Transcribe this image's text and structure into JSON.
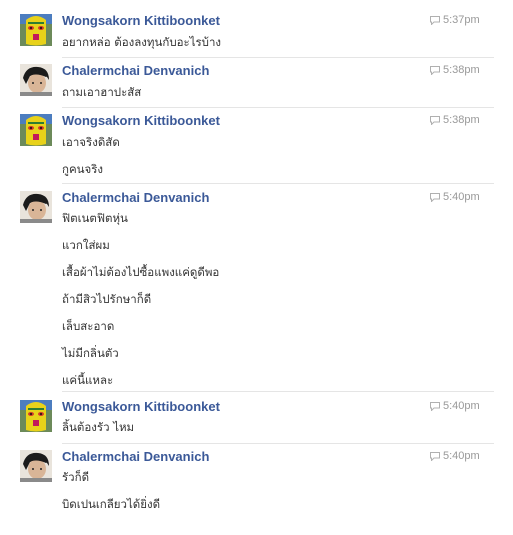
{
  "messages": [
    {
      "author": "Wongsakorn Kittiboonket",
      "avatar_icon": "mask-avatar-icon",
      "time": "5:37pm",
      "lines": [
        "อยากหล่อ ต้องลงทุนกับอะไรบ้าง"
      ]
    },
    {
      "author": "Chalermchai Denvanich",
      "avatar_icon": "person-avatar-icon",
      "time": "5:38pm",
      "lines": [
        "ถามเอาฮาปะสัส"
      ]
    },
    {
      "author": "Wongsakorn Kittiboonket",
      "avatar_icon": "mask-avatar-icon",
      "time": "5:38pm",
      "lines": [
        "เอาจริงดิสัด",
        "กูคนจริง"
      ]
    },
    {
      "author": "Chalermchai Denvanich",
      "avatar_icon": "person-avatar-icon",
      "time": "5:40pm",
      "lines": [
        "ฟิตเนตฟิตหุ่น",
        "แวกใส่ผม",
        "เสื้อผ้าไม่ต้องไปซื้อแพงแค่ดูดีพอ",
        "ถ้ามีสิวไปรักษาก็ดี",
        "เล็บสะอาด",
        "ไม่มีกลิ่นตัว",
        "แค่นี้แหละ"
      ]
    },
    {
      "author": "Wongsakorn Kittiboonket",
      "avatar_icon": "mask-avatar-icon",
      "time": "5:40pm",
      "lines": [
        "ลิ้นต้องรัว ไหม"
      ]
    },
    {
      "author": "Chalermchai Denvanich",
      "avatar_icon": "person-avatar-icon",
      "time": "5:40pm",
      "lines": [
        "รัวก็ดี",
        "บิดเปนเกลียวได้ยิ่งดี"
      ]
    }
  ],
  "colors": {
    "author": "#3b5998",
    "time": "#999999",
    "text": "#333333",
    "divider": "#e5e5e5"
  }
}
